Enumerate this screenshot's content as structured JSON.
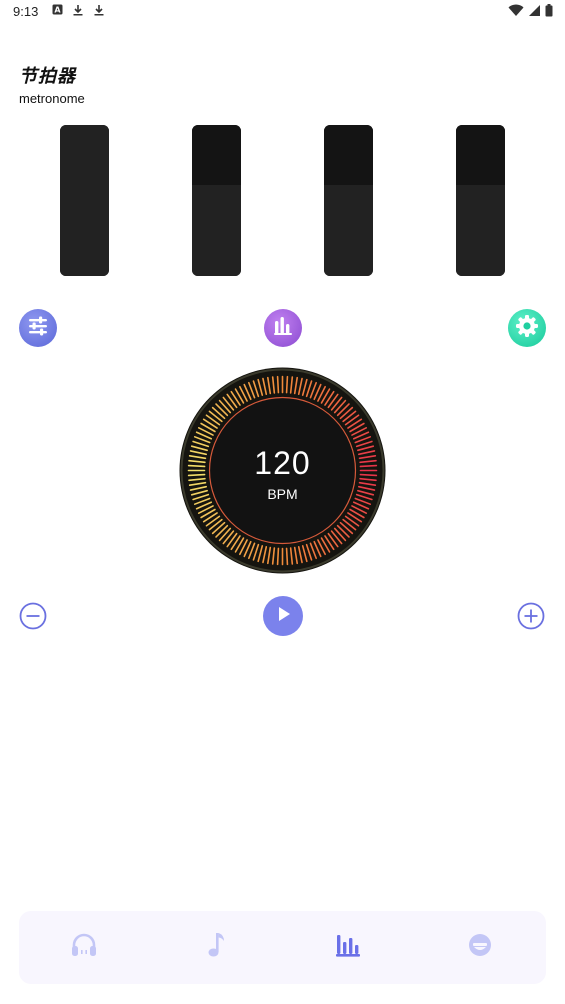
{
  "status_bar": {
    "time": "9:13",
    "left_icons": [
      "notification-a-icon",
      "download-icon",
      "download-icon"
    ],
    "right_icons": [
      "wifi-icon",
      "signal-icon",
      "battery-icon"
    ]
  },
  "header": {
    "title": "节拍器",
    "subtitle": "metronome"
  },
  "beat_bars": [
    {
      "name": "beat-1",
      "level": 1.0
    },
    {
      "name": "beat-2",
      "level": 0.6
    },
    {
      "name": "beat-3",
      "level": 0.6
    },
    {
      "name": "beat-4",
      "level": 0.6
    }
  ],
  "tool_buttons": [
    {
      "name": "mixer-button",
      "icon": "sliders-icon",
      "color": "#6a75e0"
    },
    {
      "name": "stats-button",
      "icon": "bar-chart-icon",
      "color": "#a460e0"
    },
    {
      "name": "settings-button",
      "icon": "gear-icon",
      "color": "#22d6a6"
    }
  ],
  "tempo": {
    "value": "120",
    "unit": "BPM",
    "ring_colors": [
      "#f2e06a",
      "#f08a3a",
      "#e8324a"
    ]
  },
  "controls": {
    "minus_icon": "minus-circle-icon",
    "play_icon": "play-icon",
    "plus_icon": "plus-circle-icon",
    "accent": "#7b82ec"
  },
  "bottom_nav": {
    "items": [
      {
        "name": "nav-headphones",
        "icon": "headphones-icon",
        "active": false
      },
      {
        "name": "nav-music",
        "icon": "music-note-icon",
        "active": false
      },
      {
        "name": "nav-metronome",
        "icon": "bar-chart-icon",
        "active": true
      },
      {
        "name": "nav-profile",
        "icon": "face-icon",
        "active": false
      }
    ],
    "active_color": "#6a70e8",
    "inactive_color": "#c3c6f6"
  }
}
